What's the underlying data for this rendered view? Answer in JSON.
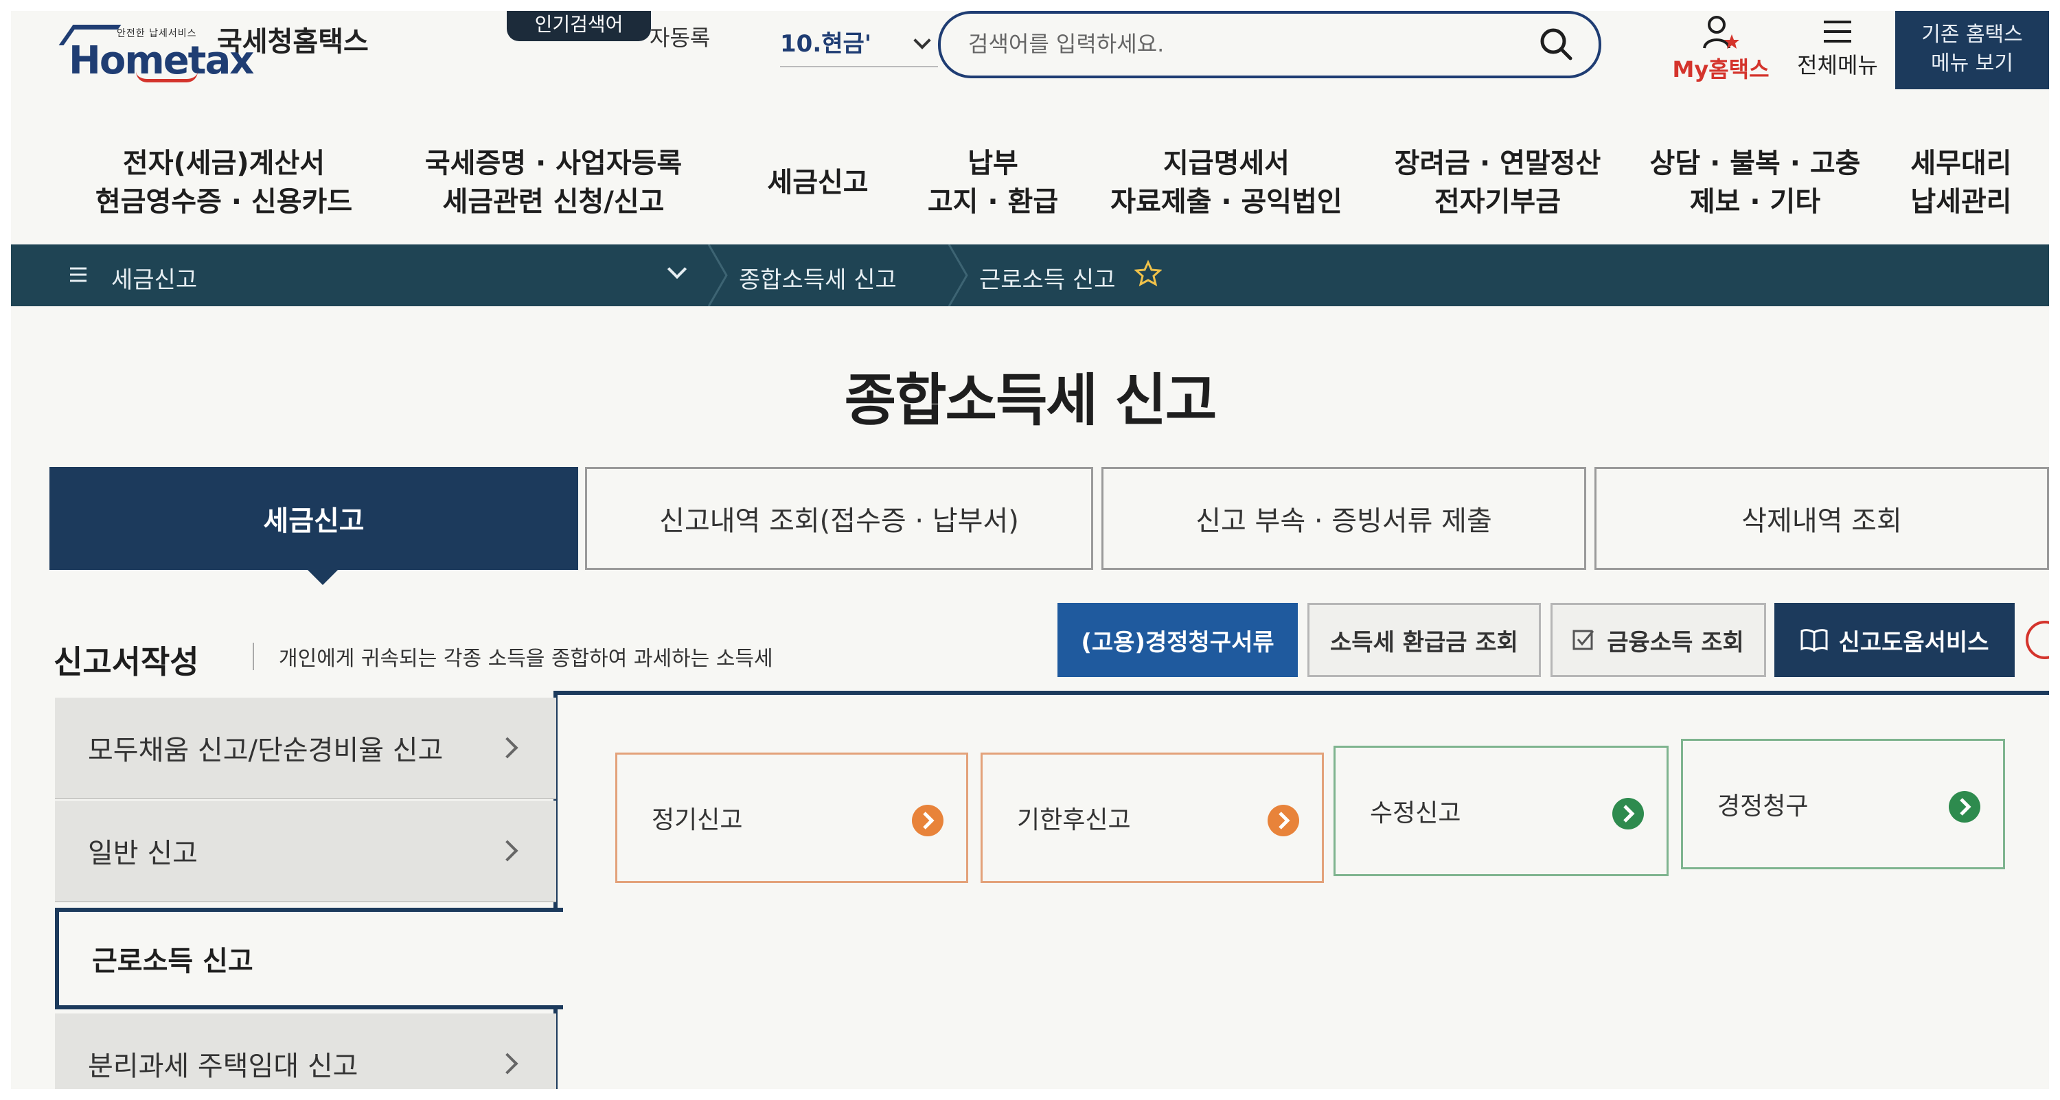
{
  "header": {
    "logo_subtitle": "안전한 납세서비스",
    "logo_text": "Hometax",
    "logo_kr": "국세청홈택스",
    "popular_badge": "인기검색어",
    "autocomplete_label": "자동록",
    "rank_value": "10.현금'",
    "search_placeholder": "검색어를 입력하세요.",
    "my_hometax": "My홈택스",
    "all_menu": "전체메뉴",
    "old_hometax": [
      "기존 홈택스",
      "메뉴 보기"
    ]
  },
  "gnb": [
    {
      "line1": "전자(세금)계산서",
      "line2": "현금영수증 · 신용카드"
    },
    {
      "line1": "국세증명 · 사업자등록",
      "line2": "세금관련 신청/신고"
    },
    {
      "line1": "세금신고",
      "line2": ""
    },
    {
      "line1": "납부",
      "line2": "고지 · 환급"
    },
    {
      "line1": "지급명세서",
      "line2": "자료제출 · 공익법인"
    },
    {
      "line1": "장려금 · 연말정산",
      "line2": "전자기부금"
    },
    {
      "line1": "상담 · 불복 · 고충",
      "line2": "제보 · 기타"
    },
    {
      "line1": "세무대리",
      "line2": "납세관리"
    }
  ],
  "breadcrumb": {
    "first": "세금신고",
    "second": "종합소득세 신고",
    "third": "근로소득 신고"
  },
  "page_title": "종합소득세 신고",
  "tabs": [
    {
      "label": "세금신고",
      "active": true
    },
    {
      "label": "신고내역 조회(접수증 · 납부서)",
      "active": false
    },
    {
      "label": "신고 부속 · 증빙서류 제출",
      "active": false
    },
    {
      "label": "삭제내역 조회",
      "active": false
    }
  ],
  "section": {
    "title": "신고서작성",
    "description": "개인에게 귀속되는 각종 소득을 종합하여 과세하는 소득세"
  },
  "actions": {
    "correction_docs": "(고용)경정청구서류",
    "refund_lookup": "소득세 환급금 조회",
    "financial_income": "금융소득 조회",
    "help_service": "신고도움서비스"
  },
  "sidebar": [
    {
      "label": "모두채움 신고/단순경비율 신고",
      "active": false
    },
    {
      "label": "일반 신고",
      "active": false
    },
    {
      "label": "근로소득 신고",
      "active": true
    },
    {
      "label": "분리과세 주택임대 신고",
      "active": false
    }
  ],
  "filing_types": [
    {
      "label": "정기신고",
      "color": "#e8833a"
    },
    {
      "label": "기한후신고",
      "color": "#e8833a"
    },
    {
      "label": "수정신고",
      "color": "#2e8b4e"
    },
    {
      "label": "경정청구",
      "color": "#2e8b4e"
    }
  ],
  "colors": {
    "navy": "#1c3a5c",
    "teal_bar": "#1f4454",
    "blue_button": "#1f5a9e",
    "brand_red": "#d4342c"
  }
}
